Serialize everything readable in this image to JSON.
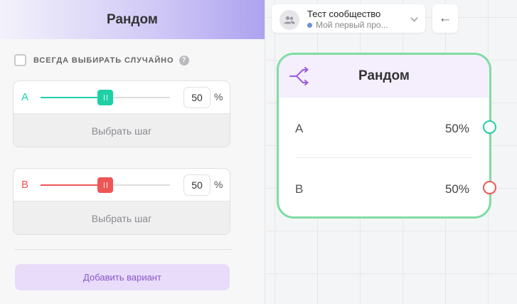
{
  "panel": {
    "title": "Рандом",
    "random_label": "ВСЕГДА ВЫБИРАТЬ СЛУЧАЙНО",
    "help_glyph": "?",
    "variants": [
      {
        "letter": "A",
        "value": "50",
        "percent_sign": "%",
        "step_label": "Выбрать шаг",
        "color": "#1fcfa6",
        "fill_fraction": 0.5
      },
      {
        "letter": "B",
        "value": "50",
        "percent_sign": "%",
        "step_label": "Выбрать шаг",
        "color": "#ee5555",
        "fill_fraction": 0.5
      }
    ],
    "add_button_label": "Добавить вариант"
  },
  "community": {
    "title": "Тест сообщество",
    "subtitle": "Мой первый про...",
    "icon": "people-icon",
    "chevron": "⌄"
  },
  "back_button": {
    "glyph": "←"
  },
  "node": {
    "title": "Рандом",
    "icon": "random-split-icon",
    "rows": [
      {
        "letter": "A",
        "percent": "50%",
        "port_color": "#1fcfa6"
      },
      {
        "letter": "B",
        "percent": "50%",
        "port_color": "#ee5555"
      }
    ],
    "border_color": "#7fdca4",
    "accent": "#9a5bdc"
  }
}
